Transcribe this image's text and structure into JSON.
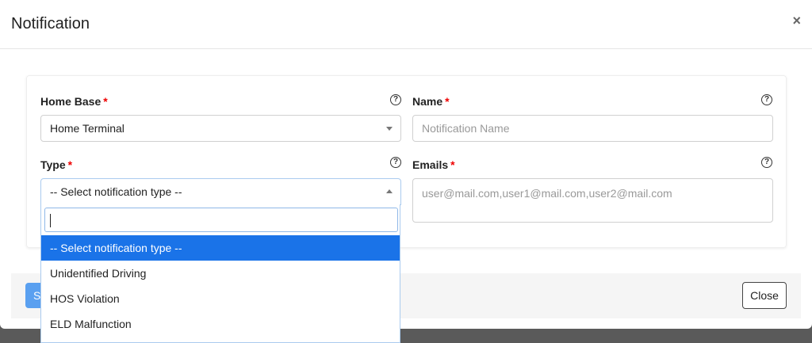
{
  "modal": {
    "title": "Notification",
    "close_icon": "×"
  },
  "form": {
    "home_base": {
      "label": "Home Base",
      "required": "*",
      "value": "Home Terminal"
    },
    "name": {
      "label": "Name",
      "required": "*",
      "placeholder": "Notification Name"
    },
    "type": {
      "label": "Type",
      "required": "*",
      "value": "-- Select notification type --"
    },
    "emails": {
      "label": "Emails",
      "required": "*",
      "placeholder": "user@mail.com,user1@mail.com,user2@mail.com"
    },
    "help_icon": "?"
  },
  "dropdown": {
    "search_value": "",
    "options": [
      "-- Select notification type --",
      "Unidentified Driving",
      "HOS Violation",
      "ELD Malfunction"
    ],
    "selected_index": 0,
    "highlight_color": "#1a73e8"
  },
  "footer": {
    "save_label": "S",
    "close_label": "Close"
  }
}
